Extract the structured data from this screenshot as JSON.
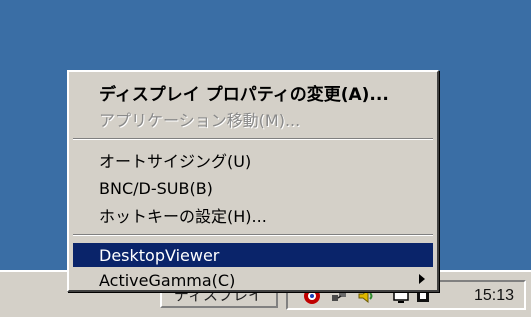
{
  "menu": {
    "items": [
      {
        "label": "ディスプレイ プロパティの変更(A)...",
        "bold": true,
        "enabled": true
      },
      {
        "label": "アプリケーション移動(M)...",
        "enabled": false
      },
      {
        "label": "オートサイジング(U)",
        "enabled": true
      },
      {
        "label": "BNC/D-SUB(B)",
        "enabled": true
      },
      {
        "label": "ホットキーの設定(H)...",
        "enabled": true
      },
      {
        "label": "DesktopViewer",
        "enabled": true,
        "highlighted": true
      },
      {
        "label": "ActiveGamma(C)",
        "enabled": true,
        "has_submenu": true
      }
    ]
  },
  "taskbar": {
    "button_fragment": "ディスプレイ",
    "tray_icons": [
      "red-shield-icon",
      "network-icon",
      "speaker-icon",
      "display-icon"
    ],
    "clock": "15:13"
  },
  "colors": {
    "desktop": "#3a6ea5",
    "menu_background": "#d4d0c8",
    "highlight": "#0a246a"
  }
}
